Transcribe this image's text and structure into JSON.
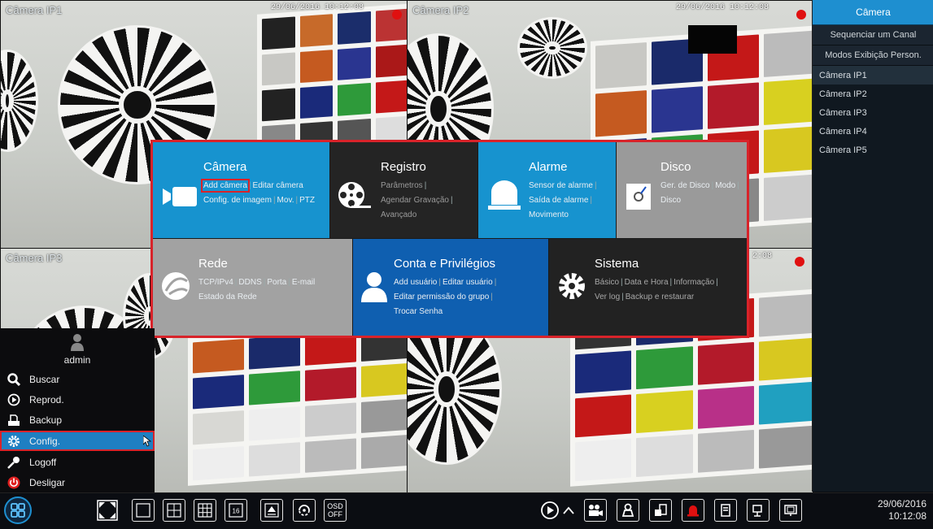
{
  "cameras": [
    {
      "label": "Câmera IP1",
      "timestamp": "29/06/2016 10:12:08"
    },
    {
      "label": "Câmera IP2",
      "timestamp": "29/06/2016 10:12:08"
    },
    {
      "label": "Câmera IP3",
      "timestamp": "2:08"
    },
    {
      "label": "",
      "timestamp": ""
    }
  ],
  "right_panel": {
    "header": "Câmera",
    "modes": [
      "Sequenciar um Canal",
      "Modos Exibição Person."
    ],
    "camera_list": [
      "Câmera IP1",
      "Câmera IP2",
      "Câmera IP3",
      "Câmera IP4",
      "Câmera IP5"
    ],
    "selected": "Câmera IP1"
  },
  "menu": {
    "camera": {
      "title": "Câmera",
      "links": [
        "Add câmera",
        "Editar câmera",
        "Config. de imagem",
        "Mov.",
        "PTZ"
      ],
      "color": "#1793cf",
      "highlighted": "Add câmera"
    },
    "registro": {
      "title": "Registro",
      "links": [
        "Parâmetros",
        "Agendar Gravação",
        "Avançado"
      ],
      "color": "#242424"
    },
    "alarme": {
      "title": "Alarme",
      "links": [
        "Sensor de alarme",
        "Saída de alarme",
        "Movimento"
      ],
      "color": "#1793cf"
    },
    "disco": {
      "title": "Disco",
      "links": [
        "Ger. de Disco",
        "Modo",
        "Disco"
      ],
      "color": "#9a9a9a"
    },
    "rede": {
      "title": "Rede",
      "links": [
        "TCP/IPv4",
        "DDNS",
        "Porta",
        "E-mail",
        "Estado da Rede"
      ],
      "color": "#a2a2a2"
    },
    "conta": {
      "title": "Conta e Privilégios",
      "links": [
        "Add usuário",
        "Editar usuário",
        "Editar permissão do grupo",
        "Trocar Senha"
      ],
      "color": "#0f5fb0"
    },
    "sistema": {
      "title": "Sistema",
      "links": [
        "Básico",
        "Data e Hora",
        "Informação",
        "Ver log",
        "Backup e restaurar"
      ],
      "color": "#222222"
    }
  },
  "start_menu": {
    "user": "admin",
    "items": [
      {
        "label": "Buscar",
        "icon": "search-icon"
      },
      {
        "label": "Reprod.",
        "icon": "play-circle-icon"
      },
      {
        "label": "Backup",
        "icon": "backup-icon"
      },
      {
        "label": "Config.",
        "icon": "gear-icon"
      },
      {
        "label": "Logoff",
        "icon": "key-icon"
      },
      {
        "label": "Desligar",
        "icon": "power-icon"
      }
    ],
    "selected": "Config."
  },
  "taskbar": {
    "osd_line1": "OSD",
    "osd_line2": "OFF",
    "date": "29/06/2016",
    "time": "10:12:08"
  },
  "colors": {
    "accent": "#1e8fd0",
    "highlight_border": "#d8232a",
    "record_dot": "#e01010"
  }
}
